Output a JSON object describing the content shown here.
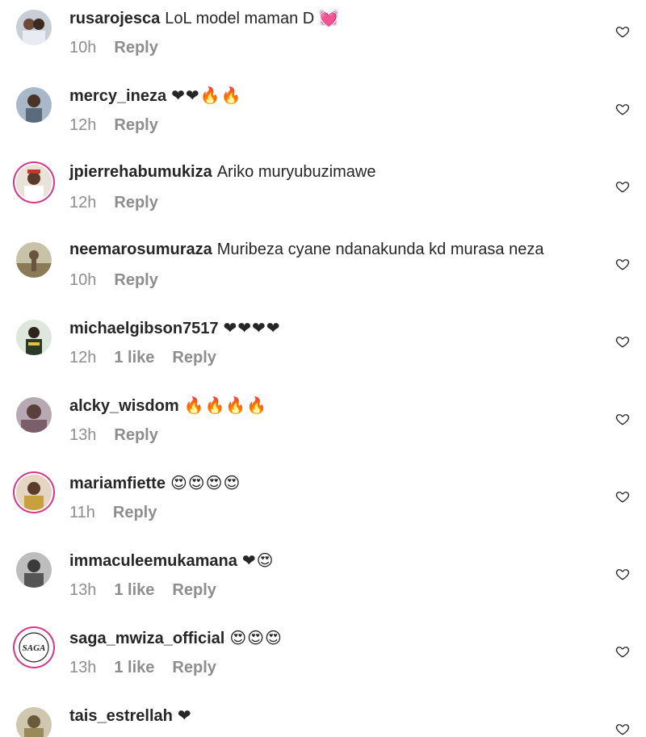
{
  "comments": [
    {
      "username": "rusarojesca",
      "text": "LoL model maman D",
      "emoji": "💓",
      "time": "10h",
      "likes": "",
      "reply": "Reply"
    },
    {
      "username": "mercy_ineza",
      "text": "",
      "emoji": "❤❤🔥🔥",
      "time": "12h",
      "likes": "",
      "reply": "Reply"
    },
    {
      "username": "jpierrehabumukiza",
      "text": "Ariko muryubuzimawe",
      "emoji": "",
      "time": "12h",
      "likes": "",
      "reply": "Reply"
    },
    {
      "username": "neemarosumuraza",
      "text": "Muribeza cyane ndanakunda kd murasa neza",
      "emoji": "",
      "time": "10h",
      "likes": "",
      "reply": "Reply"
    },
    {
      "username": "michaelgibson7517",
      "text": "",
      "emoji": "❤❤❤❤",
      "time": "12h",
      "likes": "1 like",
      "reply": "Reply"
    },
    {
      "username": "alcky_wisdom",
      "text": "",
      "emoji": "🔥🔥🔥🔥",
      "time": "13h",
      "likes": "",
      "reply": "Reply"
    },
    {
      "username": "mariamfiette",
      "text": "",
      "emoji": "😍😍😍😍",
      "time": "11h",
      "likes": "",
      "reply": "Reply"
    },
    {
      "username": "immaculeemukamana",
      "text": "",
      "emoji": "❤😍",
      "time": "13h",
      "likes": "1 like",
      "reply": "Reply"
    },
    {
      "username": "saga_mwiza_official",
      "text": "",
      "emoji": "😍😍😍",
      "time": "13h",
      "likes": "1 like",
      "reply": "Reply"
    },
    {
      "username": "tais_estrellah",
      "text": "",
      "emoji": "❤",
      "time": "",
      "likes": "",
      "reply": ""
    }
  ],
  "avatar_badge_text": "SAGA",
  "colors": {
    "meta": "#8e8e8e",
    "text": "#262626",
    "ring": "#d9358a"
  },
  "icons": {
    "like": "heart-outline-icon"
  }
}
